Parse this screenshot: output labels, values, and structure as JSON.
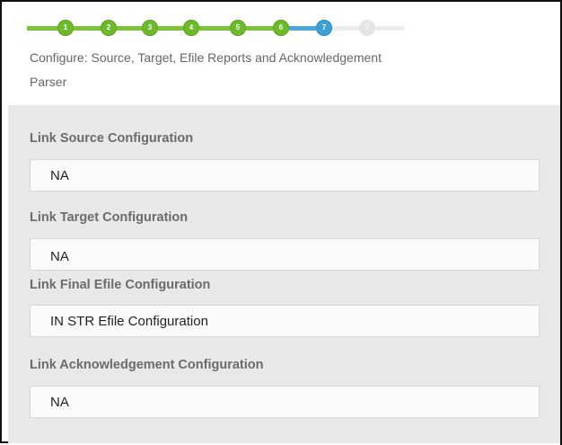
{
  "wizard": {
    "steps": [
      {
        "number": "1",
        "state": "done"
      },
      {
        "number": "2",
        "state": "done"
      },
      {
        "number": "3",
        "state": "done"
      },
      {
        "number": "4",
        "state": "done"
      },
      {
        "number": "5",
        "state": "done"
      },
      {
        "number": "6",
        "state": "done"
      },
      {
        "number": "7",
        "state": "current"
      },
      {
        "number": "8",
        "state": "pending"
      }
    ],
    "title": "Configure: Source, Target, Efile Reports and Acknowledgement Parser"
  },
  "form": {
    "fields": [
      {
        "label": "Link Source Configuration",
        "value": "NA"
      },
      {
        "label": "Link Target Configuration",
        "value": "NA"
      },
      {
        "label": "Link Final Efile Configuration",
        "value": "IN STR Efile Configuration"
      },
      {
        "label": "Link Acknowledgement Configuration",
        "value": "NA"
      }
    ]
  },
  "colors": {
    "step_done": "#6dbb2a",
    "step_current": "#3fa0d3",
    "step_pending": "#e4e4e4",
    "panel_bg": "#e8e8e8"
  }
}
